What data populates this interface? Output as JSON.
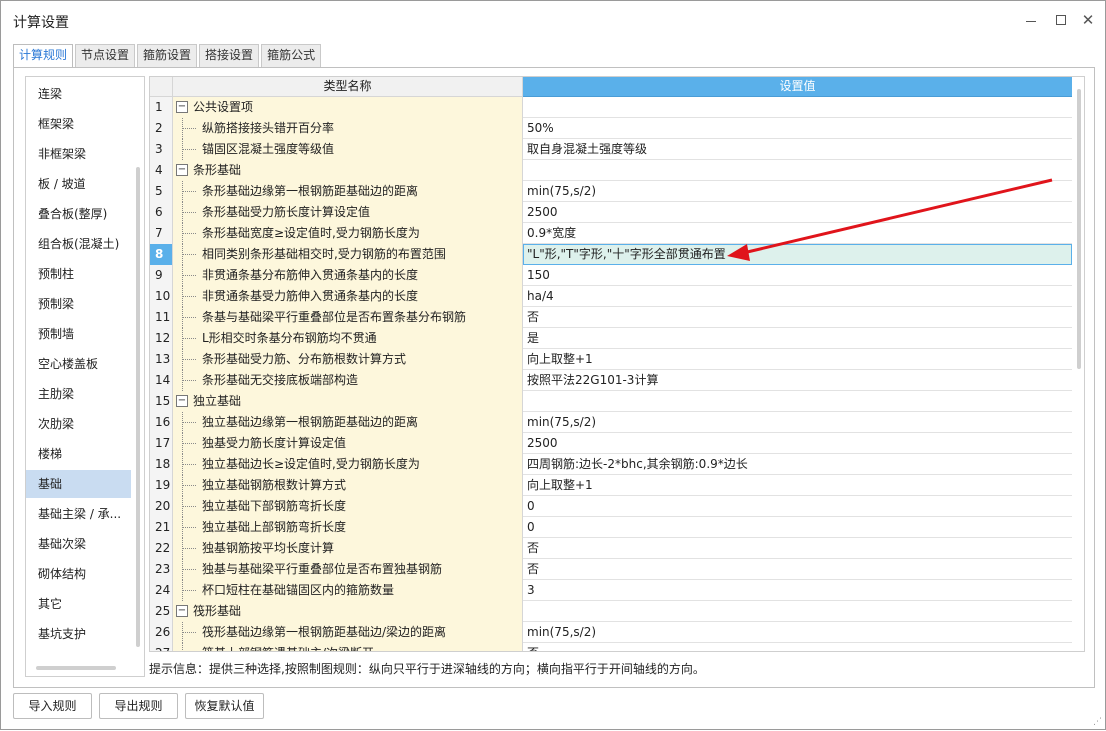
{
  "window": {
    "title": "计算设置"
  },
  "tabs": [
    {
      "label": "计算规则",
      "active": true
    },
    {
      "label": "节点设置",
      "active": false
    },
    {
      "label": "箍筋设置",
      "active": false
    },
    {
      "label": "搭接设置",
      "active": false
    },
    {
      "label": "箍筋公式",
      "active": false
    }
  ],
  "sidebar": {
    "selected": "基础",
    "items": [
      "连梁",
      "框架梁",
      "非框架梁",
      "板 / 坡道",
      "叠合板(整厚)",
      "组合板(混凝土)",
      "预制柱",
      "预制梁",
      "预制墙",
      "空心楼盖板",
      "主肋梁",
      "次肋梁",
      "楼梯",
      "基础",
      "基础主梁 / 承...",
      "基础次梁",
      "砌体结构",
      "其它",
      "基坑支护"
    ]
  },
  "grid": {
    "header_name": "类型名称",
    "header_value": "设置值",
    "selected_row": "8",
    "rows": [
      {
        "idx": "1",
        "type": "section",
        "name": "公共设置项",
        "value": ""
      },
      {
        "idx": "2",
        "type": "item",
        "name": "纵筋搭接接头错开百分率",
        "value": "50%"
      },
      {
        "idx": "3",
        "type": "item",
        "name": "锚固区混凝土强度等级值",
        "value": "取自身混凝土强度等级"
      },
      {
        "idx": "4",
        "type": "section",
        "name": "条形基础",
        "value": ""
      },
      {
        "idx": "5",
        "type": "item",
        "name": "条形基础边缘第一根钢筋距基础边的距离",
        "value": "min(75,s/2)"
      },
      {
        "idx": "6",
        "type": "item",
        "name": "条形基础受力筋长度计算设定值",
        "value": "2500"
      },
      {
        "idx": "7",
        "type": "item",
        "name": "条形基础宽度≥设定值时,受力钢筋长度为",
        "value": "0.9*宽度"
      },
      {
        "idx": "8",
        "type": "item",
        "name": "相同类别条形基础相交时,受力钢筋的布置范围",
        "value": "\"L\"形,\"T\"字形,\"十\"字形全部贯通布置"
      },
      {
        "idx": "9",
        "type": "item",
        "name": "非贯通条基分布筋伸入贯通条基内的长度",
        "value": "150"
      },
      {
        "idx": "10",
        "type": "item",
        "name": "非贯通条基受力筋伸入贯通条基内的长度",
        "value": "ha/4"
      },
      {
        "idx": "11",
        "type": "item",
        "name": "条基与基础梁平行重叠部位是否布置条基分布钢筋",
        "value": "否"
      },
      {
        "idx": "12",
        "type": "item",
        "name": "L形相交时条基分布钢筋均不贯通",
        "value": "是"
      },
      {
        "idx": "13",
        "type": "item",
        "name": "条形基础受力筋、分布筋根数计算方式",
        "value": "向上取整+1"
      },
      {
        "idx": "14",
        "type": "item",
        "name": "条形基础无交接底板端部构造",
        "value": "按照平法22G101-3计算"
      },
      {
        "idx": "15",
        "type": "section",
        "name": "独立基础",
        "value": ""
      },
      {
        "idx": "16",
        "type": "item",
        "name": "独立基础边缘第一根钢筋距基础边的距离",
        "value": "min(75,s/2)"
      },
      {
        "idx": "17",
        "type": "item",
        "name": "独基受力筋长度计算设定值",
        "value": "2500"
      },
      {
        "idx": "18",
        "type": "item",
        "name": "独立基础边长≥设定值时,受力钢筋长度为",
        "value": "四周钢筋:边长-2*bhc,其余钢筋:0.9*边长"
      },
      {
        "idx": "19",
        "type": "item",
        "name": "独立基础钢筋根数计算方式",
        "value": "向上取整+1"
      },
      {
        "idx": "20",
        "type": "item",
        "name": "独立基础下部钢筋弯折长度",
        "value": "0"
      },
      {
        "idx": "21",
        "type": "item",
        "name": "独立基础上部钢筋弯折长度",
        "value": "0"
      },
      {
        "idx": "22",
        "type": "item",
        "name": "独基钢筋按平均长度计算",
        "value": "否"
      },
      {
        "idx": "23",
        "type": "item",
        "name": "独基与基础梁平行重叠部位是否布置独基钢筋",
        "value": "否"
      },
      {
        "idx": "24",
        "type": "item",
        "name": "杯口短柱在基础锚固区内的箍筋数量",
        "value": "3"
      },
      {
        "idx": "25",
        "type": "section",
        "name": "筏形基础",
        "value": ""
      },
      {
        "idx": "26",
        "type": "item",
        "name": "筏形基础边缘第一根钢筋距基础边/梁边的距离",
        "value": "min(75,s/2)"
      },
      {
        "idx": "27",
        "type": "item",
        "name": "筏基上部钢筋遇基础主/次梁断开",
        "value": "否"
      }
    ]
  },
  "hint": "提示信息：提供三种选择,按照制图规则：纵向只平行于进深轴线的方向；横向指平行于开间轴线的方向。",
  "buttons": {
    "import": "导入规则",
    "export": "导出规则",
    "reset": "恢复默认值"
  },
  "colors": {
    "accent": "#5ab0ea",
    "name_cell_bg": "#fdf7dc",
    "sidebar_selected": "#c9dcf1",
    "annotation_arrow": "#e0141b"
  }
}
